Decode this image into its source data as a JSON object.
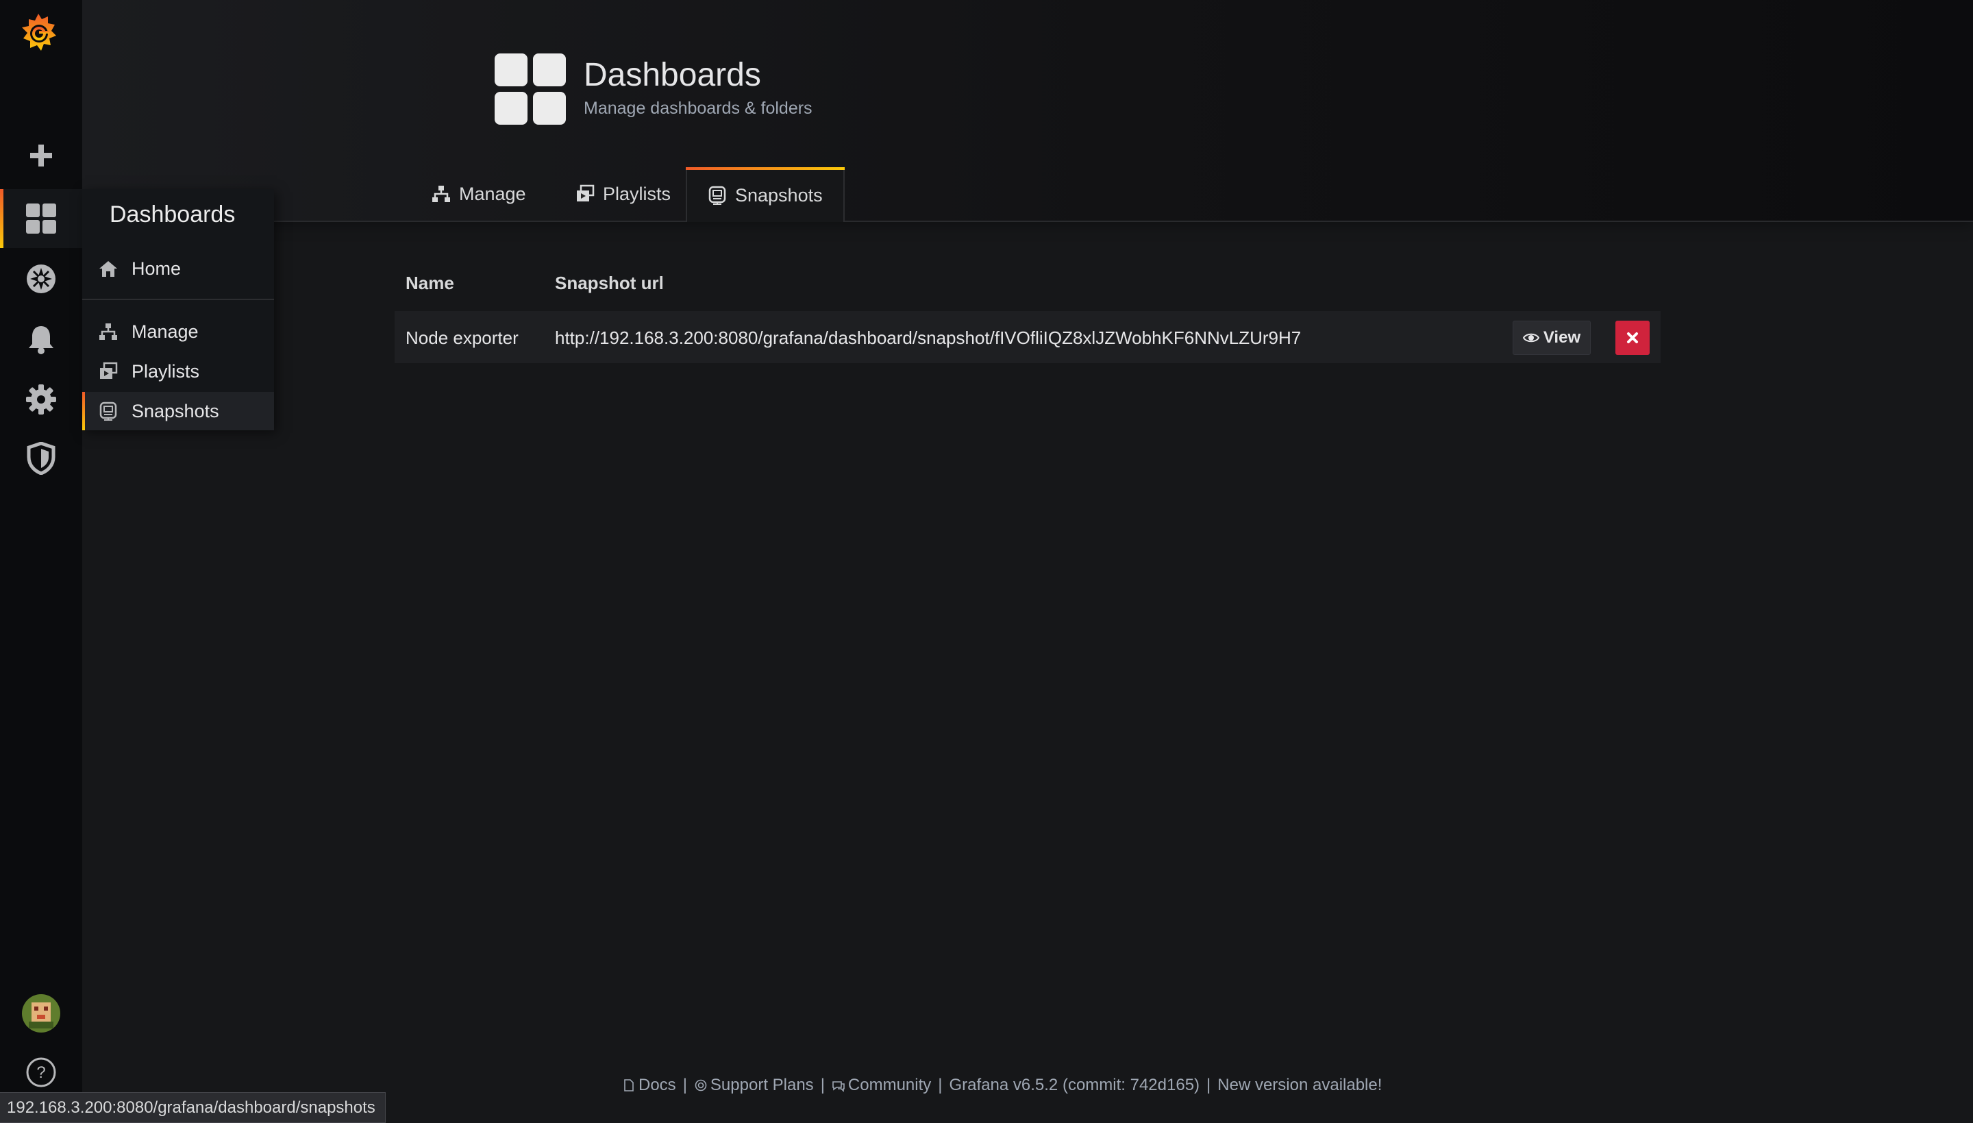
{
  "sidebar": {
    "icons": [
      "grafana-logo-icon",
      "plus-icon",
      "dashboards-icon",
      "compass-icon",
      "bell-icon",
      "gear-icon",
      "shield-icon",
      "avatar",
      "help-icon"
    ]
  },
  "dropdown": {
    "title": "Dashboards",
    "items": [
      {
        "label": "Home",
        "icon": "home-icon"
      },
      {
        "label": "Manage",
        "icon": "sitemap-icon"
      },
      {
        "label": "Playlists",
        "icon": "playlist-icon"
      },
      {
        "label": "Snapshots",
        "icon": "snapshot-icon",
        "active": true
      }
    ]
  },
  "header": {
    "title": "Dashboards",
    "subtitle": "Manage dashboards & folders",
    "tabs": [
      {
        "label": "Manage",
        "icon": "sitemap-icon"
      },
      {
        "label": "Playlists",
        "icon": "playlist-icon"
      },
      {
        "label": "Snapshots",
        "icon": "snapshot-icon",
        "active": true
      }
    ]
  },
  "table": {
    "columns": [
      "Name",
      "Snapshot url"
    ],
    "rows": [
      {
        "name": "Node exporter",
        "url": "http://192.168.3.200:8080/grafana/dashboard/snapshot/fIVOfliIQZ8xlJZWobhKF6NNvLZUr9H7",
        "view_label": "View"
      }
    ]
  },
  "footer": {
    "docs": "Docs",
    "support": "Support Plans",
    "community": "Community",
    "version": "Grafana v6.5.2 (commit: 742d165)",
    "update": "New version available!"
  },
  "statusbar": {
    "url": "192.168.3.200:8080/grafana/dashboard/snapshots"
  },
  "colors": {
    "accent_start": "#f05a28",
    "accent_end": "#fbca0a",
    "danger": "#d0233c",
    "background": "#161719",
    "sidebar": "#0b0c0e"
  }
}
